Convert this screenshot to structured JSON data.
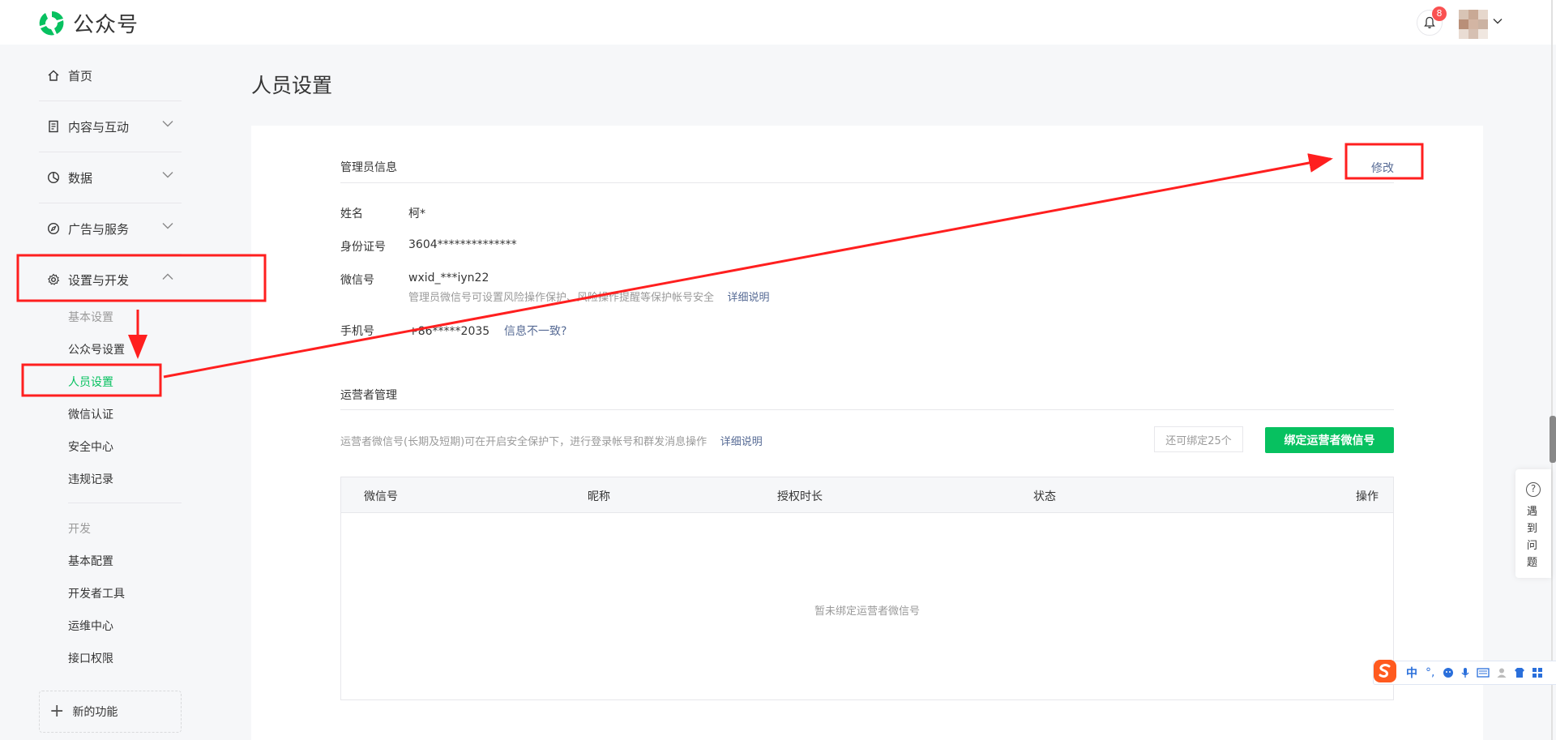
{
  "app": {
    "name": "公众号"
  },
  "topbar": {
    "notification_count": "8"
  },
  "sidebar": {
    "home": "首页",
    "content": "内容与互动",
    "data": "数据",
    "ads": "广告与服务",
    "settings": "设置与开发",
    "basic_group": "基本设置",
    "sub_items": [
      "公众号设置",
      "人员设置",
      "微信认证",
      "安全中心",
      "违规记录"
    ],
    "dev_group": "开发",
    "dev_items": [
      "基本配置",
      "开发者工具",
      "运维中心",
      "接口权限"
    ],
    "new_features": "新的功能"
  },
  "page": {
    "title": "人员设置",
    "admin": {
      "section_title": "管理员信息",
      "edit": "修改",
      "name_label": "姓名",
      "name_value": "柯*",
      "id_label": "身份证号",
      "id_value": "3604**************",
      "wechat_label": "微信号",
      "wechat_value": "wxid_***iyn22",
      "wechat_hint": "管理员微信号可设置风险操作保护、风险操作提醒等保护帐号安全",
      "detail_link": "详细说明",
      "phone_label": "手机号",
      "phone_value": "+86*****2035",
      "phone_link": "信息不一致?"
    },
    "operators": {
      "section_title": "运营者管理",
      "description": "运营者微信号(长期及短期)可在开启安全保护下，进行登录帐号和群发消息操作",
      "detail_link": "详细说明",
      "remaining": "还可绑定25个",
      "bind_button": "绑定运营者微信号",
      "columns": [
        "微信号",
        "昵称",
        "授权时长",
        "状态",
        "操作"
      ],
      "empty_text": "暂未绑定运营者微信号"
    }
  },
  "help": {
    "label": "遇到问题"
  },
  "ime": {
    "mode": "中",
    "punct": "°,"
  },
  "colors": {
    "accent_green": "#07c160",
    "link_blue": "#576b95",
    "annotation_red": "#ff1f1f"
  }
}
